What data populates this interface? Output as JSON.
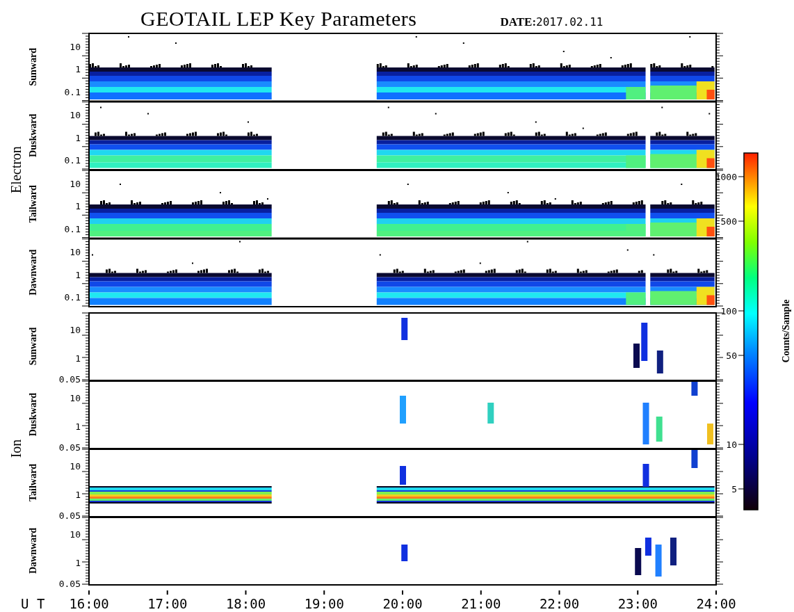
{
  "title": "GEOTAIL LEP Key Parameters",
  "date_label": "DATE:",
  "date_value": "2017.02.11",
  "groups": [
    {
      "kind": "electron",
      "species": "Electron",
      "panels": [
        {
          "direction": "Sunward",
          "yticks": [
            "10",
            "1",
            "0.1"
          ]
        },
        {
          "direction": "Duskward",
          "yticks": [
            "10",
            "1",
            "0.1"
          ]
        },
        {
          "direction": "Tailward",
          "yticks": [
            "10",
            "1",
            "0.1"
          ]
        },
        {
          "direction": "Dawnward",
          "yticks": [
            "10",
            "1",
            "0.1"
          ]
        }
      ]
    },
    {
      "kind": "ion",
      "species": "Ion",
      "panels": [
        {
          "direction": "Sunward",
          "yticks": [
            "10",
            "1",
            "0.05"
          ]
        },
        {
          "direction": "Duskward",
          "yticks": [
            "10",
            "1",
            "0.05"
          ]
        },
        {
          "direction": "Tailward",
          "yticks": [
            "10",
            "1",
            "0.05"
          ]
        },
        {
          "direction": "Dawnward",
          "yticks": [
            "10",
            "1",
            "0.05"
          ]
        }
      ]
    }
  ],
  "time_axis": {
    "label": "U T",
    "ticks": [
      "16:00",
      "17:00",
      "18:00",
      "19:00",
      "20:00",
      "21:00",
      "22:00",
      "23:00",
      "24:00"
    ]
  },
  "colorbar": {
    "label": "Counts/Sample",
    "ticks": [
      "1000",
      "500",
      "100",
      "50",
      "10",
      "5"
    ]
  }
}
